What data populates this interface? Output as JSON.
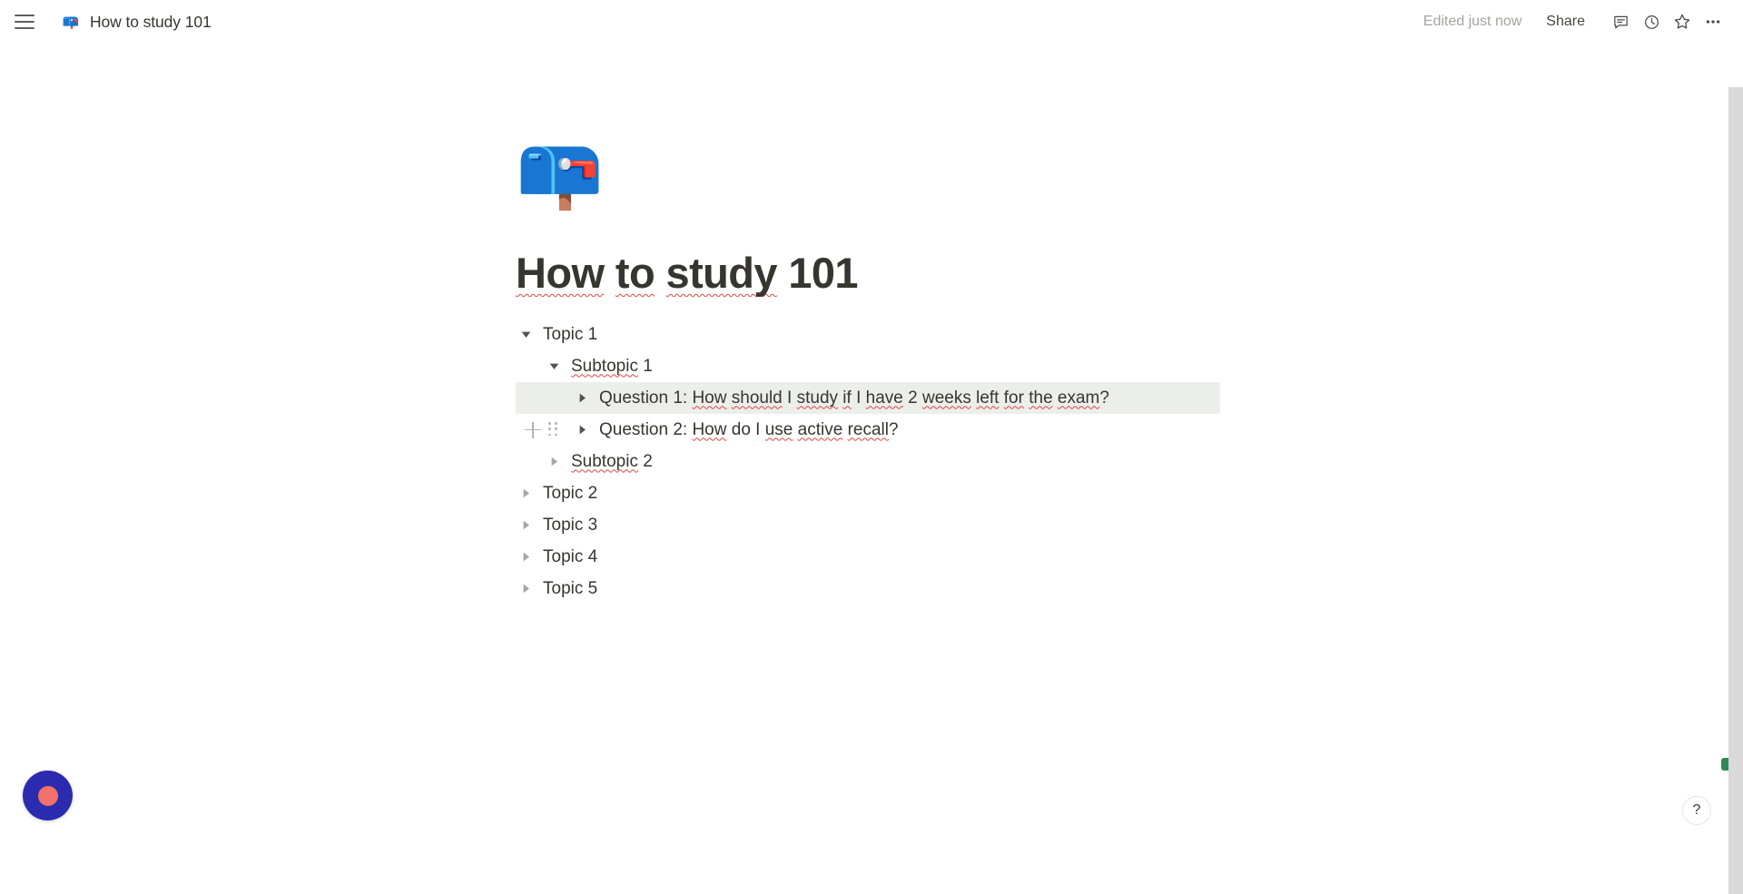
{
  "topbar": {
    "menu_icon": "hamburger-icon",
    "breadcrumb_emoji": "📪",
    "breadcrumb_title": "How to study 101",
    "edited_status": "Edited just now",
    "share_label": "Share",
    "icons": [
      {
        "name": "comment-icon",
        "label": "Comments"
      },
      {
        "name": "history-icon",
        "label": "Updates"
      },
      {
        "name": "star-icon",
        "label": "Favorite"
      },
      {
        "name": "more-options-icon",
        "label": "More"
      }
    ]
  },
  "page": {
    "emoji": "📪",
    "title": "How to study 101",
    "title_parts": [
      {
        "text": "How",
        "misspelled": true
      },
      {
        "text": " ",
        "misspelled": false
      },
      {
        "text": "to",
        "misspelled": true
      },
      {
        "text": " ",
        "misspelled": false
      },
      {
        "text": "study",
        "misspelled": true
      },
      {
        "text": " 101",
        "misspelled": false
      }
    ]
  },
  "toggles": [
    {
      "id": "topic-1",
      "label": "Topic 1",
      "indent": 0,
      "expanded": true,
      "highlighted": false,
      "gutter": false,
      "parts": [
        {
          "text": "Topic 1",
          "misspelled": false
        }
      ]
    },
    {
      "id": "subtopic-1",
      "label": "Subtopic 1",
      "indent": 1,
      "expanded": true,
      "highlighted": false,
      "gutter": false,
      "parts": [
        {
          "text": "Subtopic",
          "misspelled": true
        },
        {
          "text": " 1",
          "misspelled": false
        }
      ]
    },
    {
      "id": "question-1",
      "label": "Question 1: How should I study if I have 2 weeks left for the exam?",
      "indent": 2,
      "expanded": false,
      "highlighted": true,
      "gutter": false,
      "parts": [
        {
          "text": "Question 1: ",
          "misspelled": false
        },
        {
          "text": "How",
          "misspelled": true
        },
        {
          "text": " ",
          "misspelled": false
        },
        {
          "text": "should",
          "misspelled": true
        },
        {
          "text": " I ",
          "misspelled": false
        },
        {
          "text": "study",
          "misspelled": true
        },
        {
          "text": " ",
          "misspelled": false
        },
        {
          "text": "if",
          "misspelled": true
        },
        {
          "text": " I ",
          "misspelled": false
        },
        {
          "text": "have",
          "misspelled": true
        },
        {
          "text": " 2 ",
          "misspelled": false
        },
        {
          "text": "weeks",
          "misspelled": true
        },
        {
          "text": " ",
          "misspelled": false
        },
        {
          "text": "left",
          "misspelled": true
        },
        {
          "text": " ",
          "misspelled": false
        },
        {
          "text": "for",
          "misspelled": true
        },
        {
          "text": " ",
          "misspelled": false
        },
        {
          "text": "the",
          "misspelled": true
        },
        {
          "text": " ",
          "misspelled": false
        },
        {
          "text": "exam",
          "misspelled": true
        },
        {
          "text": "?",
          "misspelled": false
        }
      ]
    },
    {
      "id": "question-2",
      "label": "Question 2: How do I use active recall?",
      "indent": 2,
      "expanded": false,
      "highlighted": false,
      "gutter": true,
      "parts": [
        {
          "text": "Question 2: ",
          "misspelled": false
        },
        {
          "text": "How",
          "misspelled": true
        },
        {
          "text": " do I ",
          "misspelled": false
        },
        {
          "text": "use",
          "misspelled": true
        },
        {
          "text": " ",
          "misspelled": false
        },
        {
          "text": "active",
          "misspelled": true
        },
        {
          "text": " ",
          "misspelled": false
        },
        {
          "text": "recall",
          "misspelled": true
        },
        {
          "text": "?",
          "misspelled": false
        }
      ]
    },
    {
      "id": "subtopic-2",
      "label": "Subtopic 2",
      "indent": 1,
      "expanded": false,
      "highlighted": false,
      "gutter": false,
      "parts": [
        {
          "text": "Subtopic",
          "misspelled": true
        },
        {
          "text": " 2",
          "misspelled": false
        }
      ]
    },
    {
      "id": "topic-2",
      "label": "Topic 2",
      "indent": 0,
      "expanded": false,
      "highlighted": false,
      "gutter": false,
      "parts": [
        {
          "text": "Topic 2",
          "misspelled": false
        }
      ]
    },
    {
      "id": "topic-3",
      "label": "Topic 3",
      "indent": 0,
      "expanded": false,
      "highlighted": false,
      "gutter": false,
      "parts": [
        {
          "text": "Topic 3",
          "misspelled": false
        }
      ]
    },
    {
      "id": "topic-4",
      "label": "Topic 4",
      "indent": 0,
      "expanded": false,
      "highlighted": false,
      "gutter": false,
      "parts": [
        {
          "text": "Topic 4",
          "misspelled": false
        }
      ]
    },
    {
      "id": "topic-5",
      "label": "Topic 5",
      "indent": 0,
      "expanded": false,
      "highlighted": false,
      "gutter": false,
      "parts": [
        {
          "text": "Topic 5",
          "misspelled": false
        }
      ]
    }
  ],
  "gutter_controls": {
    "add_block": "+",
    "drag_handle": "drag-handle-icon"
  },
  "floating": {
    "record_button": "record-button",
    "help_label": "?",
    "status_indicator": "recording-status-indicator"
  },
  "colors": {
    "accent_record": "#2b2bb0",
    "record_inner": "#f2716b",
    "highlight_row": "#eceeea",
    "spellcheck_underline": "#e0463c",
    "status_green": "#2e8b57",
    "text_primary": "#37352f",
    "text_muted": "#a5a39e"
  }
}
